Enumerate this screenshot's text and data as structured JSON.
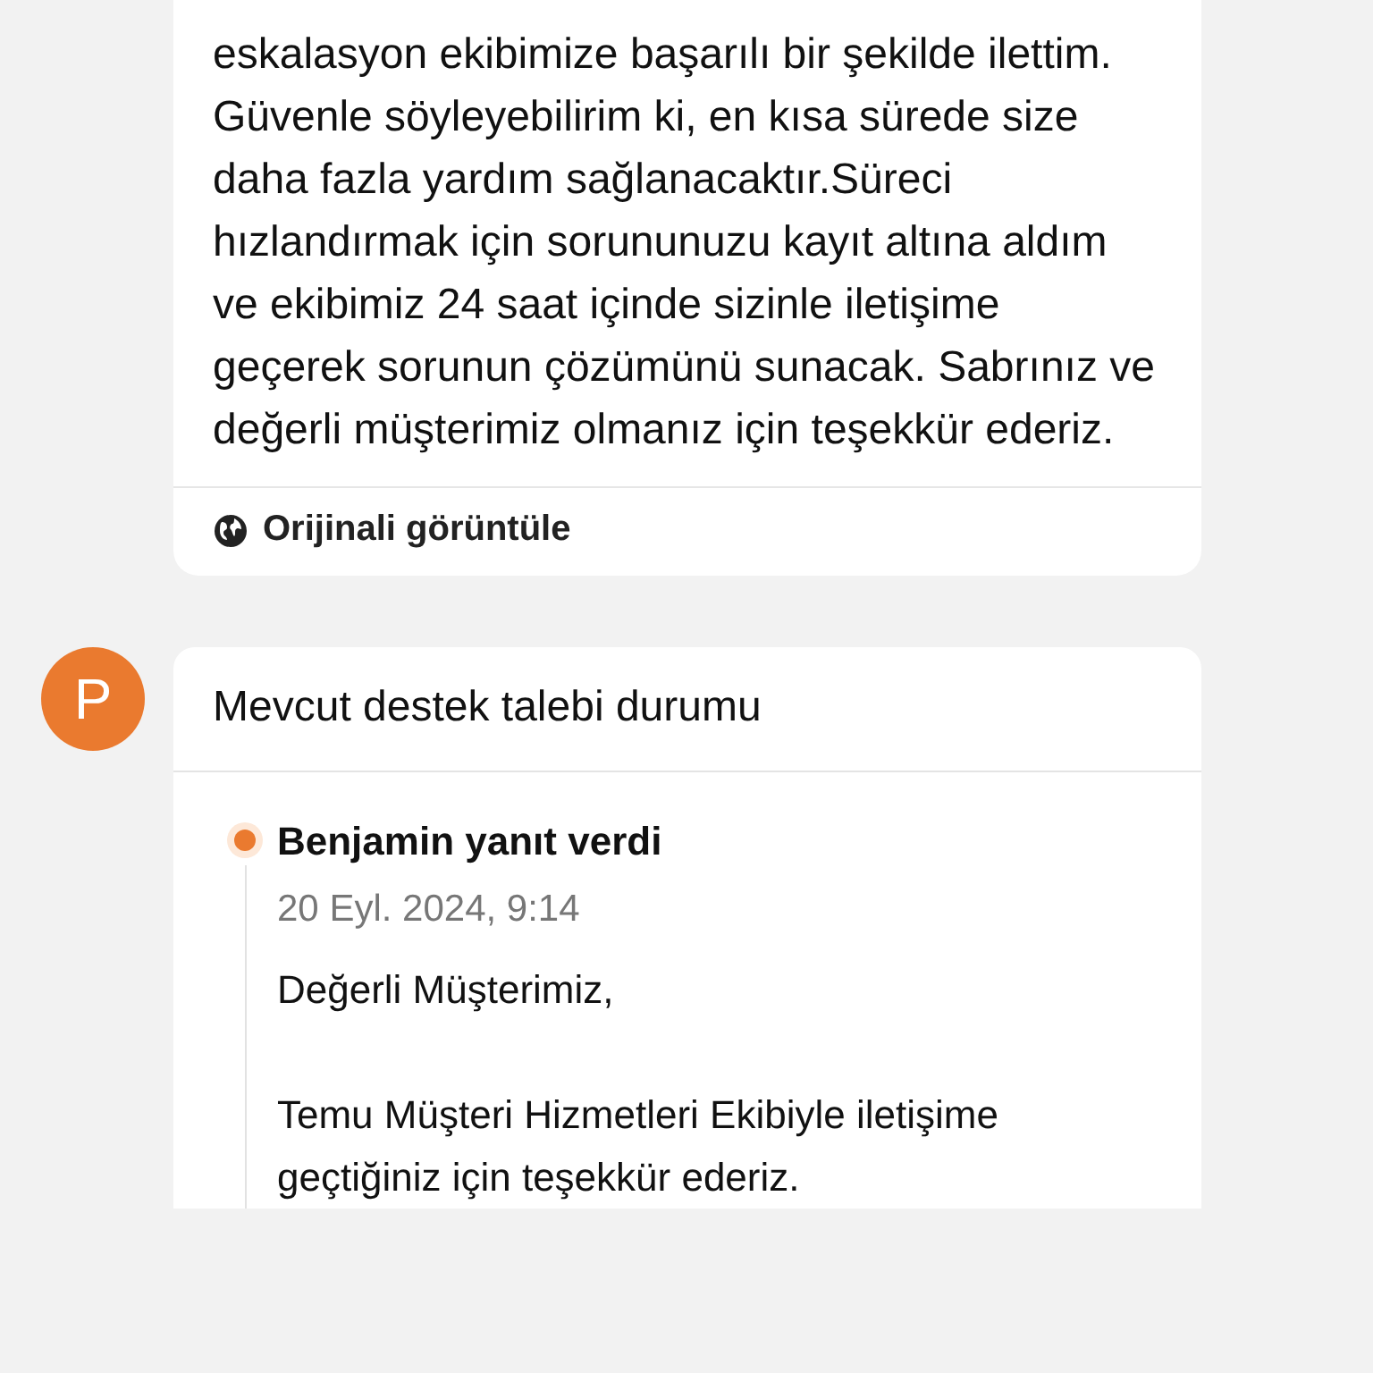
{
  "message_card": {
    "text": "eskalasyon ekibimize başarılı bir şekilde ilettim. Güvenle söyleyebilirim ki, en kısa sürede size daha fazla yardım sağlanacaktır.Süreci hızlandırmak için sorununuzu kayıt altına aldım ve ekibimiz 24 saat içinde sizinle iletişime geçerek sorunun çözümünü sunacak. Sabrınız ve değerli müşterimiz olmanız için teşekkür ederiz.",
    "link": "Orijinali görüntüle"
  },
  "status_card": {
    "avatar": "P",
    "title": "Mevcut destek talebi durumu",
    "events": [
      {
        "author": "Benjamin yanıt verdi",
        "date": "20 Eyl. 2024, 9:14",
        "paragraphs": [
          "Değerli Müşterimiz,",
          "Temu Müşteri Hizmetleri Ekibiyle iletişime geçtiğiniz için teşekkür ederiz."
        ]
      }
    ]
  }
}
